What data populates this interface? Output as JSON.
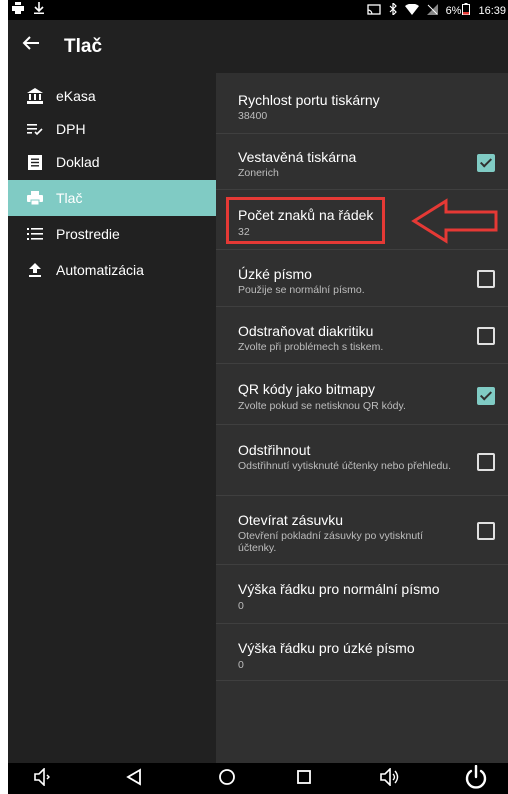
{
  "status_bar": {
    "battery": "6%",
    "time": "16:39"
  },
  "app_bar": {
    "title": "Tlač",
    "back_icon": "arrow-left-icon"
  },
  "sidebar": {
    "items": [
      {
        "label": "eKasa",
        "icon": "bank-icon",
        "active": false
      },
      {
        "label": "DPH",
        "icon": "list-check-icon",
        "active": false
      },
      {
        "label": "Doklad",
        "icon": "document-icon",
        "active": false
      },
      {
        "label": "Tlač",
        "icon": "printer-icon",
        "active": true
      },
      {
        "label": "Prostredie",
        "icon": "list-icon",
        "active": false
      },
      {
        "label": "Automatizácia",
        "icon": "upload-icon",
        "active": false
      }
    ]
  },
  "preferences": [
    {
      "title": "Rychlost portu tiskárny",
      "summary": "38400",
      "checkbox": null
    },
    {
      "title": "Vestavěná tiskárna",
      "summary": "Zonerich",
      "checkbox": true
    },
    {
      "title": "Počet znaků na řádek",
      "summary": "32",
      "checkbox": null
    },
    {
      "title": "Úzké písmo",
      "summary": "Použije se normální písmo.",
      "checkbox": false
    },
    {
      "title": "Odstraňovat diakritiku",
      "summary": "Zvolte při problémech s tiskem.",
      "checkbox": false
    },
    {
      "title": "QR kódy jako bitmapy",
      "summary": "Zvolte pokud se netisknou QR kódy.",
      "checkbox": true
    },
    {
      "title": "Odstřihnout",
      "summary": "Odstřihnutí vytisknuté účtenky nebo přehledu.",
      "checkbox": false
    },
    {
      "title": "Otevírat zásuvku",
      "summary": "Otevření pokladní zásuvky po vytisknutí účtenky.",
      "checkbox": false
    },
    {
      "title": "Výška řádku pro normální písmo",
      "summary": "0",
      "checkbox": null
    },
    {
      "title": "Výška řádku pro úzké písmo",
      "summary": "0",
      "checkbox": null
    }
  ],
  "annotation": {
    "highlight_color": "#e53935"
  },
  "colors": {
    "accent": "#80cbc4",
    "sidebar_bg": "#212121",
    "content_bg": "#303030"
  }
}
